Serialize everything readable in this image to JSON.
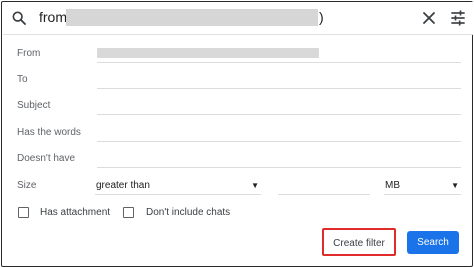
{
  "search": {
    "query_prefix": "from:",
    "query_suffix": ")",
    "search_icon": "search-icon",
    "close_icon": "close-icon",
    "options_icon": "tune-icon"
  },
  "form": {
    "from_label": "From",
    "to_label": "To",
    "subject_label": "Subject",
    "has_words_label": "Has the words",
    "doesnt_have_label": "Doesn't have",
    "size_label": "Size",
    "size_comparator": "greater than",
    "size_value": "",
    "size_unit": "MB",
    "has_attachment_label": "Has attachment",
    "has_attachment_checked": false,
    "dont_include_chats_label": "Don't include chats",
    "dont_include_chats_checked": false
  },
  "actions": {
    "create_filter_label": "Create filter",
    "search_label": "Search"
  },
  "colors": {
    "primary": "#1a73e8",
    "highlight": "#e12b2b"
  }
}
